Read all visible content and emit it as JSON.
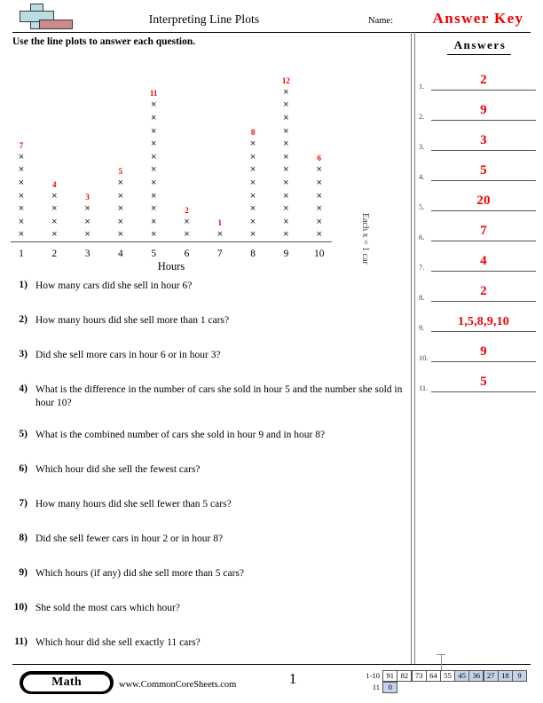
{
  "header": {
    "title": "Interpreting Line Plots",
    "name_label": "Name:",
    "answer_key": "Answer Key",
    "logo_icon": "plus-block-logo"
  },
  "instruction": "Use the line plots to answer each question.",
  "answers_panel": {
    "heading": "Answers",
    "rows": [
      {
        "num": "1.",
        "value": "2"
      },
      {
        "num": "2.",
        "value": "9"
      },
      {
        "num": "3.",
        "value": "3"
      },
      {
        "num": "4.",
        "value": "5"
      },
      {
        "num": "5.",
        "value": "20"
      },
      {
        "num": "6.",
        "value": "7"
      },
      {
        "num": "7.",
        "value": "4"
      },
      {
        "num": "8.",
        "value": "2"
      },
      {
        "num": "9.",
        "value": "1,5,8,9,10"
      },
      {
        "num": "10.",
        "value": "9"
      },
      {
        "num": "11.",
        "value": "5"
      }
    ]
  },
  "chart_data": {
    "type": "line-plot",
    "title": "",
    "xlabel": "Hours",
    "ylabel": "",
    "legend": "Each x = 1 car",
    "marker": "×",
    "categories": [
      "1",
      "2",
      "3",
      "4",
      "5",
      "6",
      "7",
      "8",
      "9",
      "10"
    ],
    "values": [
      7,
      4,
      3,
      5,
      11,
      2,
      1,
      8,
      12,
      6
    ],
    "count_labels": [
      "7",
      "4",
      "3",
      "5",
      "11",
      "2",
      "1",
      "8",
      "12",
      "6"
    ],
    "count_label_color": "#ee0000",
    "ylim": [
      0,
      12
    ],
    "grid": false
  },
  "questions": [
    {
      "num": "1)",
      "text": "How many cars did she sell in hour 6?"
    },
    {
      "num": "2)",
      "text": "How many hours did she sell more than 1 cars?"
    },
    {
      "num": "3)",
      "text": "Did she sell more cars in hour 6 or in hour 3?"
    },
    {
      "num": "4)",
      "text": "What is the difference in the number of cars she sold in hour 5 and the number she sold in hour 10?"
    },
    {
      "num": "5)",
      "text": "What is the combined number of cars she sold in hour 9 and in hour 8?"
    },
    {
      "num": "6)",
      "text": "Which hour did she sell the fewest cars?"
    },
    {
      "num": "7)",
      "text": "How many hours did she sell fewer than 5 cars?"
    },
    {
      "num": "8)",
      "text": "Did she sell fewer cars in hour 2 or in hour 8?"
    },
    {
      "num": "9)",
      "text": "Which hours (if any) did she sell more than 5 cars?"
    },
    {
      "num": "10)",
      "text": "She sold the most cars which hour?"
    },
    {
      "num": "11)",
      "text": "Which hour did she sell exactly 11 cars?"
    }
  ],
  "footer": {
    "subject": "Math",
    "url": "www.CommonCoreSheets.com",
    "page": "1",
    "score_grid": {
      "row1_label": "1-10",
      "row1_values": [
        "91",
        "82",
        "73",
        "64",
        "55",
        "45",
        "36",
        "27",
        "18",
        "9"
      ],
      "row1_shaded": [
        false,
        false,
        false,
        false,
        false,
        true,
        true,
        true,
        true,
        true
      ],
      "row2_label": "11",
      "row2_values": [
        "0"
      ],
      "row2_shaded": [
        true
      ],
      "shade_color": "#c3d3ec"
    }
  }
}
